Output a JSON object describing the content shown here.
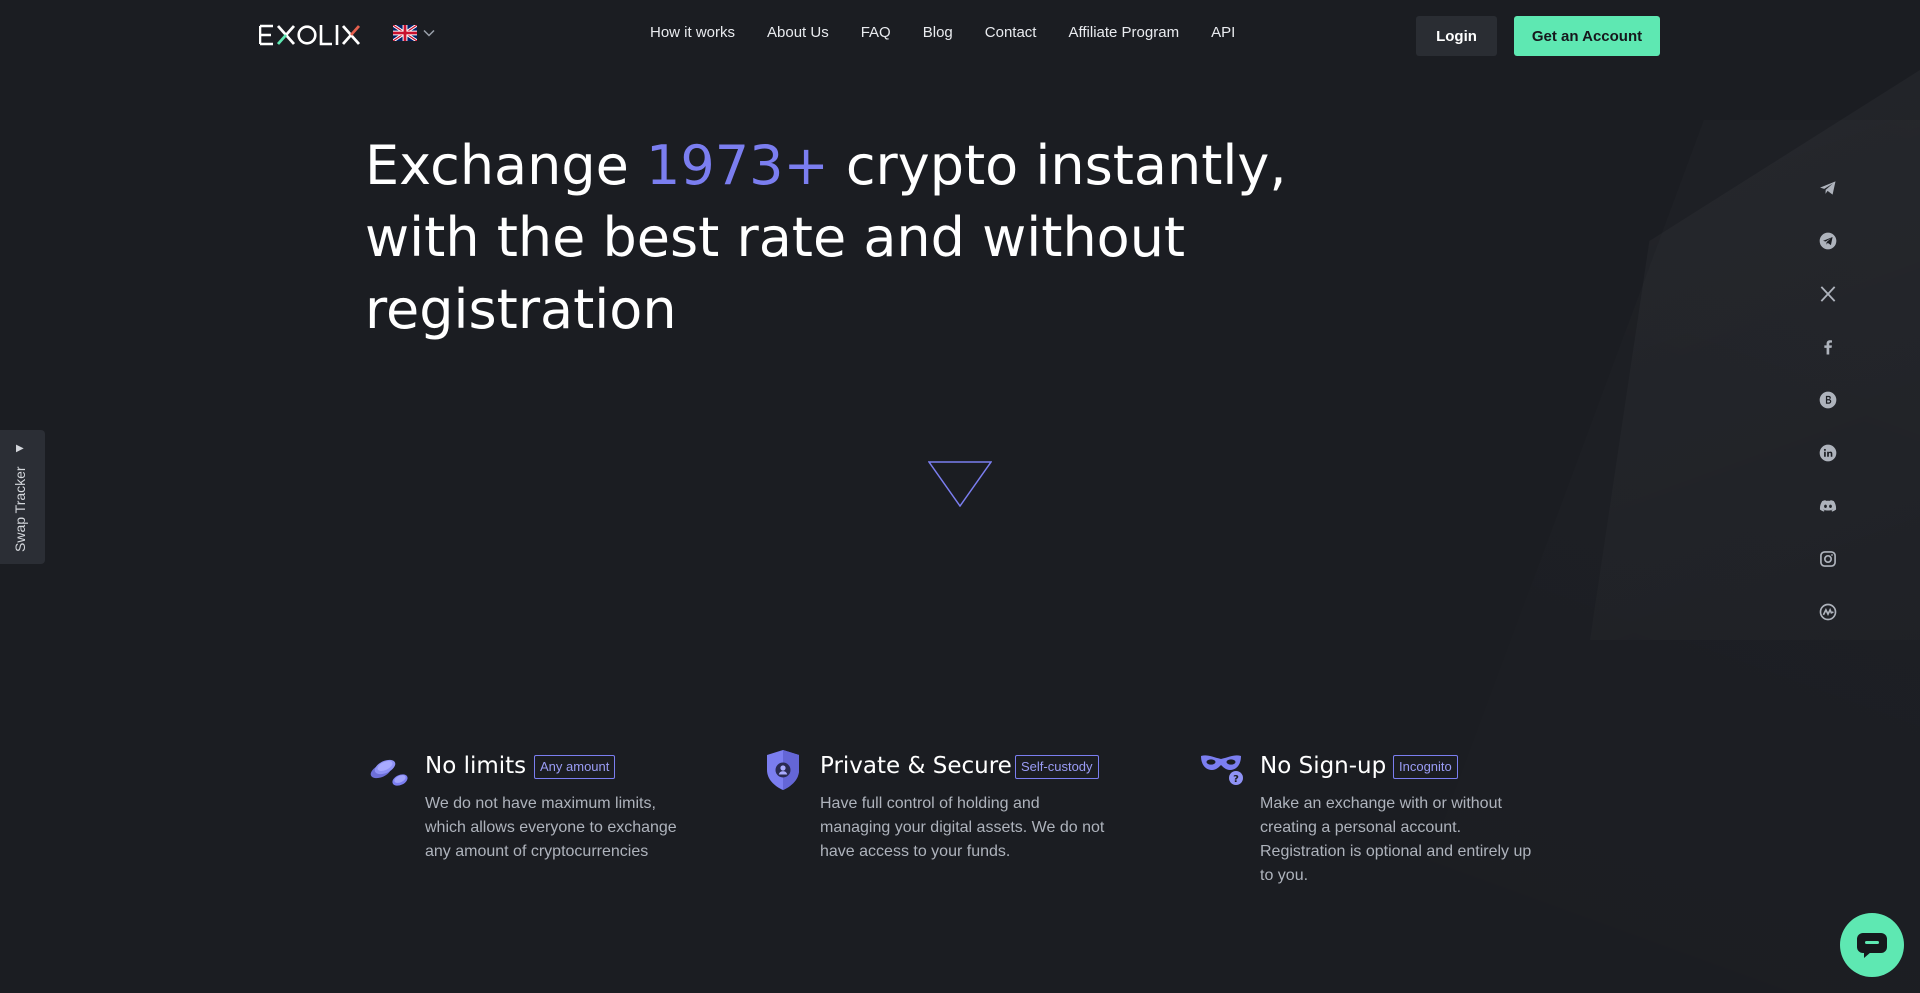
{
  "header": {
    "logo_text": "EXOLIX",
    "language": "English",
    "nav": [
      "How it works",
      "About Us",
      "FAQ",
      "Blog",
      "Contact",
      "Affiliate Program",
      "API"
    ],
    "login_label": "Login",
    "account_label": "Get an Account"
  },
  "hero": {
    "title_prefix": "Exchange ",
    "title_accent": "1973+",
    "title_rest": " crypto instantly, with the best rate and without registration"
  },
  "swap_tracker": {
    "label": "Swap Tracker"
  },
  "social": [
    "telegram-icon",
    "telegram-channel-icon",
    "x-icon",
    "facebook-icon",
    "bitcoin-icon",
    "linkedin-icon",
    "discord-icon",
    "instagram-icon",
    "coinmarketcap-icon"
  ],
  "features": [
    {
      "title": "No limits",
      "badge": "Any amount",
      "desc_lines": [
        "We do not have maximum limits,",
        "which allows everyone to exchange",
        "any amount of cryptocurrencies"
      ]
    },
    {
      "title": "Private & Secure",
      "badge": "Self-custody",
      "desc_lines": [
        "Have full control of holding and",
        "managing your digital assets. We do not",
        "have access to your funds."
      ]
    },
    {
      "title": "No Sign-up",
      "badge": "Incognito",
      "desc_lines": [
        "Make an exchange with or without",
        "creating a personal account.",
        "Registration is optional and entirely up",
        "to you."
      ]
    }
  ],
  "colors": {
    "background": "#1b1d22",
    "accent_purple": "#7b7ef0",
    "accent_green": "#5ee8b2"
  }
}
